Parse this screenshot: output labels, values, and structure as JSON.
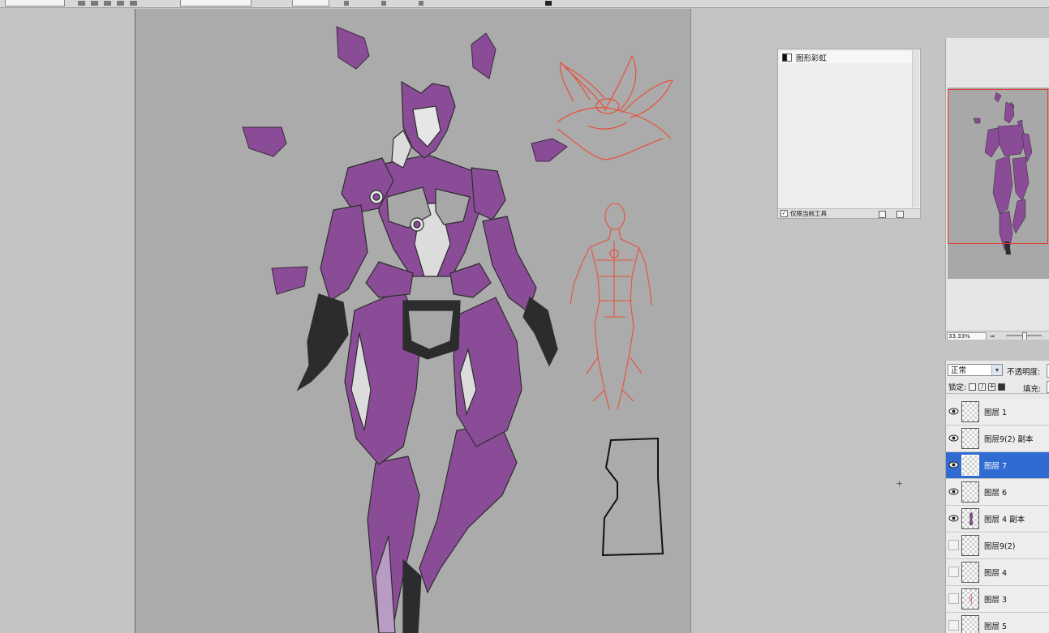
{
  "tool_presets": {
    "item": "图形彩虹",
    "checkbox_label": "仅限当前工具",
    "checked": true
  },
  "navigator": {
    "zoom": "33.33%"
  },
  "layers": {
    "blend_mode": "正常",
    "opacity_label": "不透明度:",
    "lock_label": "锁定:",
    "fill_label": "填充:",
    "items": [
      {
        "name": "图层 1",
        "visible": true,
        "selected": false
      },
      {
        "name": "图层9(2) 副本",
        "visible": true,
        "selected": false
      },
      {
        "name": "图层 7",
        "visible": true,
        "selected": true
      },
      {
        "name": "图层 6",
        "visible": true,
        "selected": false
      },
      {
        "name": "图层 4 副本",
        "visible": true,
        "selected": false
      },
      {
        "name": "图层9(2)",
        "visible": false,
        "selected": false
      },
      {
        "name": "图层 4",
        "visible": false,
        "selected": false
      },
      {
        "name": "图层 3",
        "visible": false,
        "selected": false
      },
      {
        "name": "图层 5",
        "visible": false,
        "selected": false
      }
    ]
  },
  "colors": {
    "canvas_bg": "#ababab",
    "armor_purple": "#8a4c96",
    "armor_dark": "#2c2c2e",
    "armor_light": "#dcdcdc",
    "sketch_red": "#e8503a",
    "selection_blue": "#2f6bd0"
  }
}
